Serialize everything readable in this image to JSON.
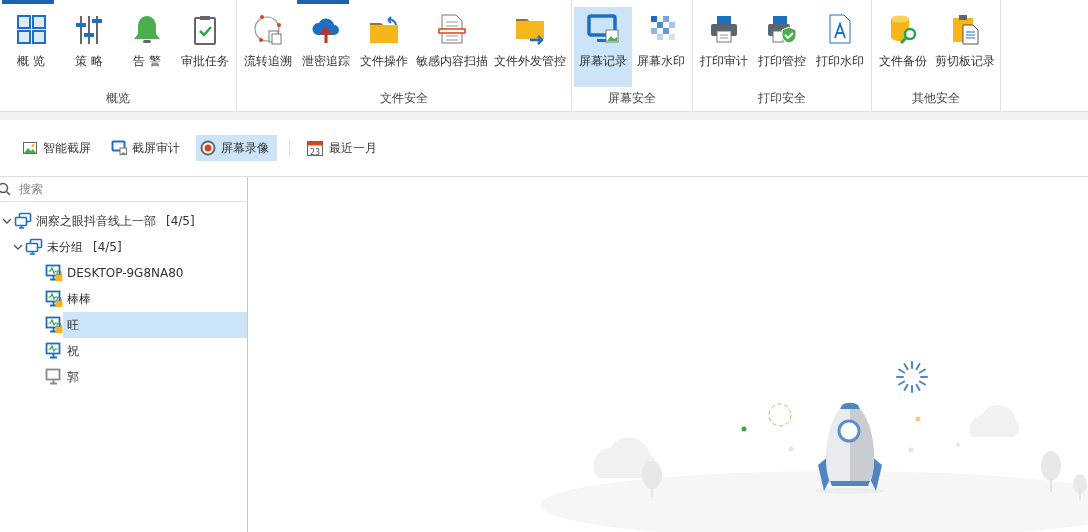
{
  "ribbon": {
    "groups": [
      {
        "label": "概览",
        "items": [
          {
            "label": "概 览",
            "selected": false,
            "highlighted": true
          },
          {
            "label": "策 略",
            "selected": false,
            "highlighted": false
          },
          {
            "label": "告 警",
            "selected": false,
            "highlighted": false
          },
          {
            "label": "审批任务",
            "selected": false,
            "highlighted": false
          }
        ]
      },
      {
        "label": "文件安全",
        "items": [
          {
            "label": "流转追溯",
            "selected": false,
            "highlighted": false
          },
          {
            "label": "泄密追踪",
            "selected": false,
            "highlighted": true
          },
          {
            "label": "文件操作",
            "selected": false,
            "highlighted": false
          },
          {
            "label": "敏感内容扫描",
            "selected": false,
            "highlighted": false
          },
          {
            "label": "文件外发管控",
            "selected": false,
            "highlighted": false
          }
        ]
      },
      {
        "label": "屏幕安全",
        "items": [
          {
            "label": "屏幕记录",
            "selected": true,
            "highlighted": false
          },
          {
            "label": "屏幕水印",
            "selected": false,
            "highlighted": false
          }
        ]
      },
      {
        "label": "打印安全",
        "items": [
          {
            "label": "打印审计",
            "selected": false,
            "highlighted": false
          },
          {
            "label": "打印管控",
            "selected": false,
            "highlighted": false
          },
          {
            "label": "打印水印",
            "selected": false,
            "highlighted": false
          }
        ]
      },
      {
        "label": "其他安全",
        "items": [
          {
            "label": "文件备份",
            "selected": false,
            "highlighted": false
          },
          {
            "label": "剪切板记录",
            "selected": false,
            "highlighted": false
          }
        ]
      }
    ]
  },
  "toolbar": {
    "buttons": [
      {
        "label": "智能截屏",
        "selected": false
      },
      {
        "label": "截屏审计",
        "selected": false
      },
      {
        "label": "屏幕录像",
        "selected": true
      }
    ],
    "date_range": {
      "label": "最近一月",
      "calendar_day": "23"
    }
  },
  "search": {
    "placeholder": "搜索"
  },
  "tree": [
    {
      "label": "洞察之眼抖音线上一部",
      "count": "[4/5]",
      "expanded": true,
      "selected": false,
      "children": [
        {
          "label": "未分组",
          "count": "[4/5]",
          "expanded": true,
          "selected": false,
          "children": [
            {
              "label": "DESKTOP-9G8NA80",
              "online": true,
              "locked": true,
              "selected": false
            },
            {
              "label": "棒棒",
              "online": true,
              "locked": true,
              "selected": false
            },
            {
              "label": "旺",
              "online": true,
              "locked": true,
              "selected": true
            },
            {
              "label": "祝",
              "online": true,
              "locked": false,
              "selected": false
            },
            {
              "label": "郭",
              "online": false,
              "locked": false,
              "selected": false
            }
          ]
        }
      ]
    }
  ]
}
